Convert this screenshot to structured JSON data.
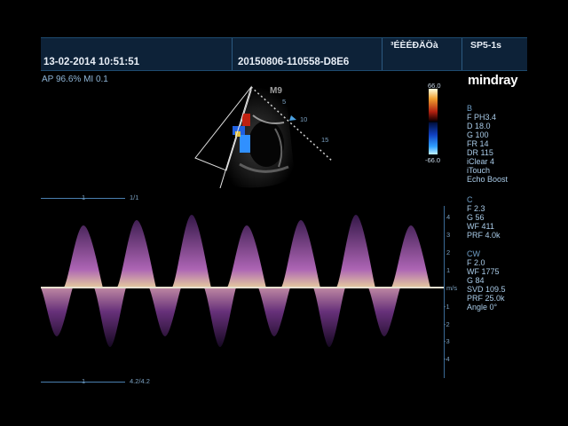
{
  "header": {
    "datetime": "13-02-2014 10:51:51",
    "study_id": "20150806-110558-D8E6",
    "hospital": "³ÉÈÉÐÄÖà",
    "probe": "SP5-1s"
  },
  "brand": "mindray",
  "status": {
    "ap_mi": "AP 96.6%  MI 0.1"
  },
  "color_bar": {
    "max": "66.0",
    "min": "-66.0"
  },
  "sector": {
    "mode_label": "M9",
    "depth_marks": [
      "5",
      "10",
      "15"
    ]
  },
  "params": {
    "b": {
      "title": "B",
      "items": [
        "F PH3.4",
        "D 18.0",
        "G 100",
        "FR 14",
        "DR 115",
        "iClear 4",
        "iTouch",
        "Echo Boost"
      ]
    },
    "c": {
      "title": "C",
      "items": [
        "F 2.3",
        "G 56",
        "WF 411",
        "PRF 4.0k"
      ]
    },
    "cw": {
      "title": "CW",
      "items": [
        "F 2.0",
        "WF 1775",
        "G 84",
        "SVD 109.5",
        "PRF 25.0k",
        "Angle 0°"
      ]
    }
  },
  "doppler": {
    "top_ruler_label": "1/1",
    "top_ruler_mark": "1",
    "bottom_ruler_label": "4.2/4.2",
    "bottom_ruler_mark": "1",
    "unit": "m/s",
    "scale_pos": [
      "4",
      "3",
      "2",
      "1"
    ],
    "scale_neg": [
      "-1",
      "-2",
      "-3",
      "-4"
    ]
  },
  "colors": {
    "accent": "#4aa0e0",
    "header_bg": "#0d2238",
    "spectrum": "#c070c8"
  }
}
